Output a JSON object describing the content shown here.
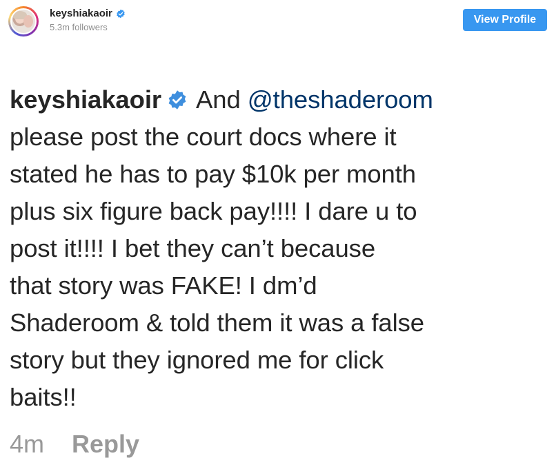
{
  "header": {
    "username": "keyshiakaoir",
    "followers": "5.3m followers",
    "view_profile_label": "View Profile"
  },
  "comment": {
    "username": "keyshiakaoir",
    "line1_text": " And ",
    "mention": "@theshaderoom",
    "lines": [
      "please post the court docs where it",
      "stated he has to pay $10k per month",
      "plus six figure back pay!!!! I dare u to",
      "post it!!!! I bet they can’t because",
      "that story was FAKE! I dm’d",
      "Shaderoom & told them it was a false",
      "story but they ignored me for click",
      "baits!!"
    ],
    "time": "4m",
    "reply_label": "Reply"
  },
  "colors": {
    "accent": "#3897f0",
    "mention": "#003569",
    "muted": "#999999",
    "text": "#262626"
  }
}
